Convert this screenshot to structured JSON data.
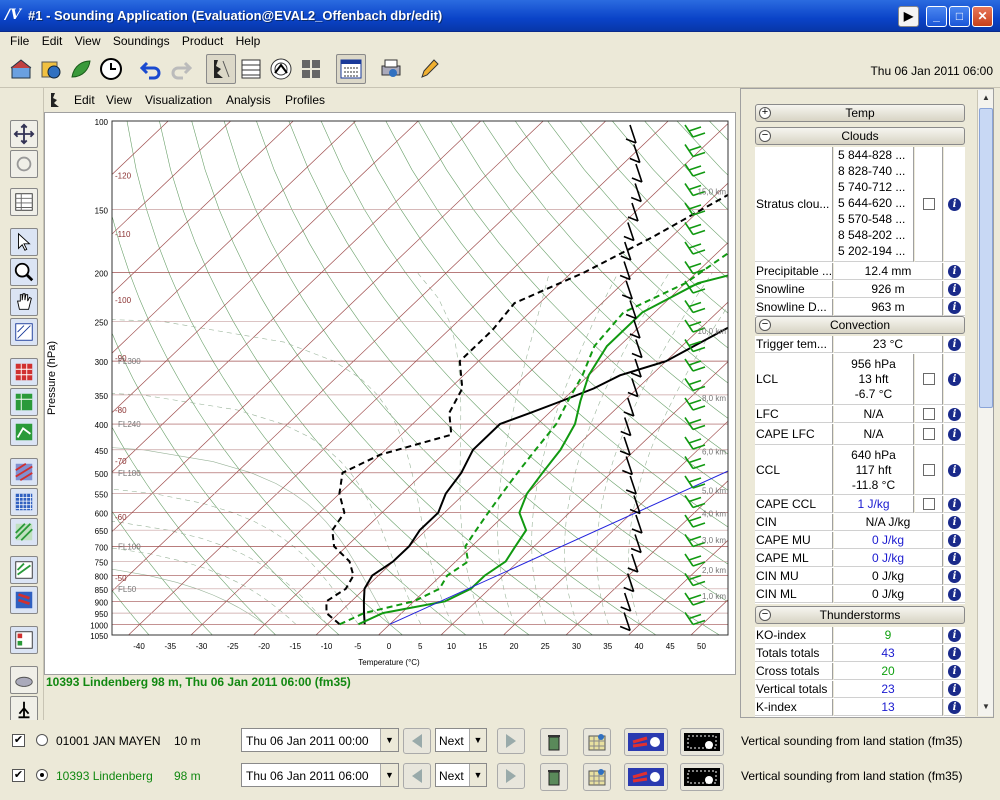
{
  "window": {
    "title": "#1 - Sounding Application (Evaluation@EVAL2_Offenbach dbr/edit)"
  },
  "menu": [
    "File",
    "Edit",
    "View",
    "Soundings",
    "Product",
    "Help"
  ],
  "toolbar": {
    "datetime": "Thu 06 Jan 2011 06:00"
  },
  "submenu": [
    "Edit",
    "View",
    "Visualization",
    "Analysis",
    "Profiles"
  ],
  "chart_data": {
    "type": "line",
    "title": "",
    "xlabel": "Temperature (°C)",
    "ylabel": "Pressure (hPa)",
    "xlim": [
      -45,
      55
    ],
    "x_ticks": [
      -40,
      -35,
      -30,
      -25,
      -20,
      -15,
      -10,
      -5,
      0,
      5,
      10,
      15,
      20,
      25,
      30,
      35,
      40,
      45,
      50
    ],
    "y_ticks": [
      100,
      150,
      200,
      250,
      300,
      350,
      400,
      450,
      500,
      550,
      600,
      650,
      700,
      750,
      800,
      850,
      900,
      950,
      1000,
      1050
    ],
    "scale": "log-pressure",
    "left_temp_labels": [
      "-120",
      "-110",
      "-100",
      "-90",
      "-80",
      "-70",
      "-60",
      "-50"
    ],
    "flight_levels": [
      "FL300",
      "FL240",
      "FL180",
      "FL100",
      "FL50"
    ],
    "height_labels": [
      "15,0 km",
      "10,0 km",
      "8,0 km",
      "6,0 km",
      "5,0 km",
      "4,0 km",
      "3,0 km",
      "2,0 km",
      "1,0 km"
    ],
    "series": [
      {
        "color": "#000000",
        "style": "solid",
        "points": [
          [
            -4,
            1000
          ],
          [
            -6,
            950
          ],
          [
            -8,
            900
          ],
          [
            -10,
            850
          ],
          [
            -11,
            800
          ],
          [
            -10,
            750
          ],
          [
            -10,
            700
          ],
          [
            -11,
            650
          ],
          [
            -11,
            600
          ],
          [
            -13,
            550
          ],
          [
            -14,
            500
          ],
          [
            -16,
            450
          ],
          [
            -16,
            400
          ],
          [
            -13,
            380
          ],
          [
            -10,
            360
          ],
          [
            -7,
            340
          ],
          [
            -5,
            320
          ],
          [
            0,
            300
          ],
          [
            4,
            260
          ],
          [
            9,
            220
          ],
          [
            14,
            190
          ],
          [
            20,
            160
          ],
          [
            26,
            130
          ],
          [
            31,
            100
          ]
        ]
      },
      {
        "color": "#000000",
        "style": "dashed",
        "points": [
          [
            -8,
            1000
          ],
          [
            -12,
            950
          ],
          [
            -14,
            900
          ],
          [
            -13,
            850
          ],
          [
            -14,
            800
          ],
          [
            -17,
            750
          ],
          [
            -22,
            700
          ],
          [
            -25,
            650
          ],
          [
            -26,
            600
          ],
          [
            -30,
            550
          ],
          [
            -33,
            500
          ],
          [
            -30,
            460
          ],
          [
            -22,
            420
          ],
          [
            -26,
            380
          ],
          [
            -28,
            340
          ],
          [
            -33,
            300
          ],
          [
            -33,
            260
          ],
          [
            -34,
            230
          ],
          [
            -28,
            200
          ],
          [
            -23,
            170
          ],
          [
            -18,
            140
          ],
          [
            -10,
            115
          ],
          [
            -5,
            100
          ]
        ]
      },
      {
        "color": "#119911",
        "style": "solid",
        "points": [
          [
            -5,
            1000
          ],
          [
            -3,
            950
          ],
          [
            5,
            900
          ],
          [
            7,
            850
          ],
          [
            7,
            800
          ],
          [
            8,
            750
          ],
          [
            7,
            700
          ],
          [
            6,
            650
          ],
          [
            2,
            600
          ],
          [
            0,
            550
          ],
          [
            -1,
            500
          ],
          [
            -2,
            450
          ],
          [
            -4,
            400
          ],
          [
            -7,
            360
          ],
          [
            -10,
            320
          ],
          [
            -12,
            280
          ],
          [
            -12,
            240
          ],
          [
            -8,
            210
          ],
          [
            2,
            190
          ],
          [
            5,
            160
          ],
          [
            10,
            120
          ],
          [
            16,
            100
          ]
        ]
      },
      {
        "color": "#119911",
        "style": "dashed",
        "points": [
          [
            -8,
            1000
          ],
          [
            -6,
            950
          ],
          [
            0,
            900
          ],
          [
            2,
            850
          ],
          [
            1,
            800
          ],
          [
            2,
            750
          ],
          [
            -1,
            700
          ],
          [
            -2,
            650
          ],
          [
            -3,
            600
          ],
          [
            -4,
            550
          ],
          [
            -5,
            500
          ],
          [
            -6,
            450
          ],
          [
            -7,
            400
          ],
          [
            -9,
            360
          ],
          [
            -11,
            320
          ],
          [
            -14,
            280
          ],
          [
            -15,
            240
          ],
          [
            -10,
            210
          ],
          [
            -8,
            180
          ],
          [
            -3,
            150
          ],
          [
            0,
            120
          ],
          [
            5,
            100
          ]
        ]
      },
      {
        "color": "#2222dd",
        "style": "solid",
        "points": [
          [
            0,
            1000
          ],
          [
            53,
            270
          ]
        ]
      }
    ]
  },
  "status": "10393 Lindenberg 98 m, Thu 06 Jan 2011 06:00 (fm35)",
  "panel": {
    "temp": "Temp",
    "clouds": "Clouds",
    "stratus_label": "Stratus clou...",
    "stratus_values": [
      "5  844-828 ...",
      "8  828-740 ...",
      "5  740-712 ...",
      "5  644-620 ...",
      "5  570-548 ...",
      "8  548-202 ...",
      "5  202-194 ..."
    ],
    "precip_label": "Precipitable ...",
    "precip_val": "12.4 mm",
    "snowline_label": "Snowline",
    "snowline_val": "926 m",
    "snowlined_label": "Snowline D...",
    "snowlined_val": "963 m",
    "convection": "Convection",
    "trigger_label": "Trigger tem...",
    "trigger_val": "23 °C",
    "lcl_label": "LCL",
    "lcl_vals": [
      "956 hPa",
      "13 hft",
      "-6.7 °C"
    ],
    "lfc_label": "LFC",
    "lfc_val": "N/A",
    "capelfc_label": "CAPE LFC",
    "capelfc_val": "N/A",
    "ccl_label": "CCL",
    "ccl_vals": [
      "640 hPa",
      "117 hft",
      "-11.8 °C"
    ],
    "capeccl_label": "CAPE CCL",
    "capeccl_val": "1 J/kg",
    "cin_label": "CIN",
    "cin_val": "N/A J/kg",
    "capemu_label": "CAPE MU",
    "capemu_val": "0 J/kg",
    "capeml_label": "CAPE ML",
    "capeml_val": "0 J/kg",
    "cinmu_label": "CIN MU",
    "cinmu_val": "0 J/kg",
    "cinml_label": "CIN ML",
    "cinml_val": "0 J/kg",
    "thunder": "Thunderstorms",
    "ko_label": "KO-index",
    "ko_val": "9",
    "tt_label": "Totals totals",
    "tt_val": "43",
    "ct_label": "Cross totals",
    "ct_val": "20",
    "vt_label": "Vertical totals",
    "vt_val": "23",
    "k_label": "K-index",
    "k_val": "13"
  },
  "stations": [
    {
      "checked": "✔",
      "name": "01001 JAN MAYEN",
      "alt": "10 m",
      "date": "Thu 06 Jan 2011 00:00",
      "next": "Next",
      "desc": "Vertical sounding from land station (fm35)",
      "color": "#000000"
    },
    {
      "checked": "✔",
      "name": "10393 Lindenberg",
      "alt": "98 m",
      "date": "Thu 06 Jan 2011 06:00",
      "next": "Next",
      "desc": "Vertical sounding from land station (fm35)",
      "color": "#118811"
    }
  ]
}
